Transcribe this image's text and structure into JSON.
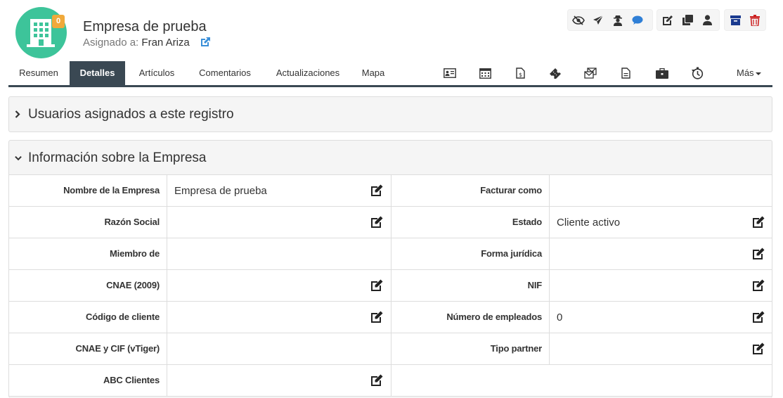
{
  "header": {
    "title": "Empresa de prueba",
    "assigned_label": "Asignado a:",
    "assigned_to": "Fran Ariza",
    "badge_count": "0",
    "avatar_color": "#3dc49a",
    "badge_color": "#f0a93b"
  },
  "toolbar_icons": {
    "group1": [
      "eye-slash-icon",
      "paper-plane-icon",
      "user-secret-icon",
      "comment-icon"
    ],
    "group2": [
      "edit-icon",
      "clone-icon",
      "user-icon"
    ],
    "group3": [
      "archive-icon",
      "trash-icon"
    ]
  },
  "tabs": [
    {
      "label": "Resumen",
      "active": false
    },
    {
      "label": "Detalles",
      "active": true
    },
    {
      "label": "Artículos",
      "active": false
    },
    {
      "label": "Comentarios",
      "active": false
    },
    {
      "label": "Actualizaciones",
      "active": false
    },
    {
      "label": "Mapa",
      "active": false
    }
  ],
  "tab_tools": [
    "id-card-icon",
    "calendar-icon",
    "file-invoice-icon",
    "ticket-icon",
    "envelopes-icon",
    "file-alt-icon",
    "briefcase-icon",
    "history-icon"
  ],
  "more_label": "Más",
  "panels": {
    "users": {
      "title": "Usuarios asignados a este registro"
    },
    "info": {
      "title": "Información sobre la Empresa"
    }
  },
  "fields": [
    {
      "left_label": "Nombre de la Empresa",
      "left_value": "Empresa de prueba",
      "right_label": "Facturar como",
      "right_value": ""
    },
    {
      "left_label": "Razón Social",
      "left_value": "",
      "right_label": "Estado",
      "right_value": "Cliente activo"
    },
    {
      "left_label": "Miembro de",
      "left_value": "",
      "right_label": "Forma jurídica",
      "right_value": ""
    },
    {
      "left_label": "CNAE (2009)",
      "left_value": "",
      "right_label": "NIF",
      "right_value": ""
    },
    {
      "left_label": "Código de cliente",
      "left_value": "",
      "right_label": "Número de empleados",
      "right_value": "0"
    },
    {
      "left_label": "CNAE y CIF (vTiger)",
      "left_value": "",
      "right_label": "Tipo partner",
      "right_value": ""
    },
    {
      "left_label": "ABC Clientes",
      "left_value": "",
      "right_label": "",
      "right_value": ""
    }
  ],
  "colors": {
    "tab_active": "#3a4853",
    "archive": "#1a3a8f",
    "trash": "#cc2222",
    "link": "#3a8fd8",
    "comment": "#2f7fd6"
  }
}
